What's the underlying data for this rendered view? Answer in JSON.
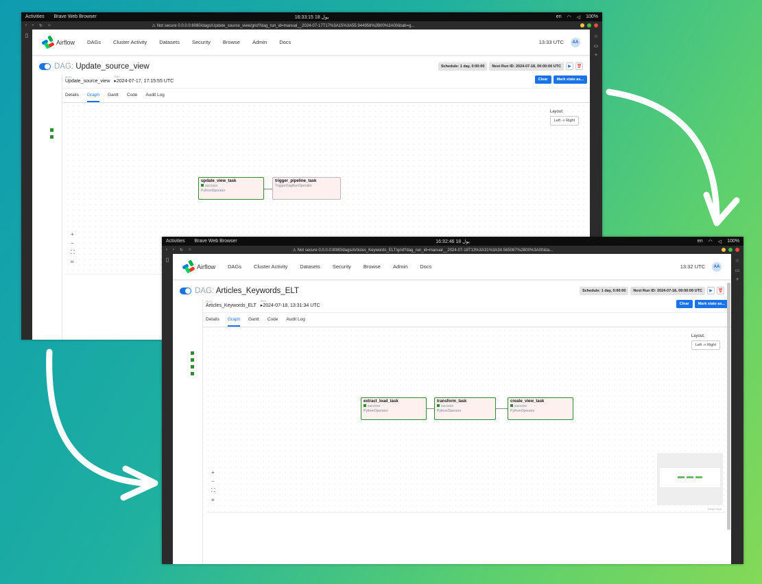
{
  "system": {
    "activities_label": "Activities",
    "browser_name": "Brave Web Browser",
    "language": "en",
    "battery": "100%"
  },
  "common": {
    "nav": {
      "logo_text": "Airflow",
      "items": [
        "DAGs",
        "Cluster Activity",
        "Datasets",
        "Security",
        "Browse",
        "Admin",
        "Docs"
      ],
      "avatar": "AA"
    },
    "url_prefix": "Not secure",
    "dag_prefix": "DAG:",
    "run_label": "Run",
    "dag_label": "DAG",
    "clear_label": "Clear",
    "mark_state_label": "Mark state as...",
    "tabs": [
      "Details",
      "Graph",
      "Gantt",
      "Code",
      "Audit Log"
    ],
    "layout_label": "Layout:",
    "layout_value": "Left -> Right",
    "task_status": "success",
    "react_flow": "React Flow"
  },
  "screenshot_back": {
    "clock": "16:33:15  18 يول",
    "url": "0.0.0.0:8080/dags/Update_source_view/grid?dag_run_id=manual__2024-07-17T17%3A15%3A55.944958%2B00%3A00&tab=g...",
    "utc_time": "13:33 UTC",
    "dag_id": "Update_source_view",
    "schedule": "Schedule: 1 day, 0:00:00",
    "next_run": "Next Run ID: 2024-07-18, 00:00:00 UTC",
    "run_dag": "Update_source_view",
    "run_time": "2024-07-17, 17:15:55 UTC",
    "tasks": [
      {
        "name": "update_view_task",
        "status": "success",
        "operator": "PythonOperator"
      },
      {
        "name": "trigger_pipeline_task",
        "status": "",
        "operator": "TriggerDagRunOperator"
      }
    ]
  },
  "screenshot_front": {
    "clock": "16:32:46  18 يول",
    "url": "0.0.0.0:8080/dags/Articles_Keywords_ELT/grid?dag_run_id=manual__2024-07-18T13%3A31%3A34.565087%2B00%3A00&ta...",
    "utc_time": "13:32 UTC",
    "dag_id": "Articles_Keywords_ELT",
    "schedule": "Schedule: 1 day, 0:00:00",
    "next_run": "Next Run ID: 2024-07-18, 00:00:00 UTC",
    "run_dag": "Articles_Keywords_ELT",
    "run_time": "2024-07-18, 13:31:34 UTC",
    "tasks": [
      {
        "name": "extract_load_task",
        "status": "success",
        "operator": "PythonOperator"
      },
      {
        "name": "transform_task",
        "status": "success",
        "operator": "PythonOperator"
      },
      {
        "name": "create_view_task",
        "status": "success",
        "operator": "PythonOperator"
      }
    ]
  },
  "colors": {
    "accent": "#1a73e8",
    "success": "#2e8b2e",
    "node_bg": "#fdf0ee",
    "arrow": "#ffffff"
  }
}
